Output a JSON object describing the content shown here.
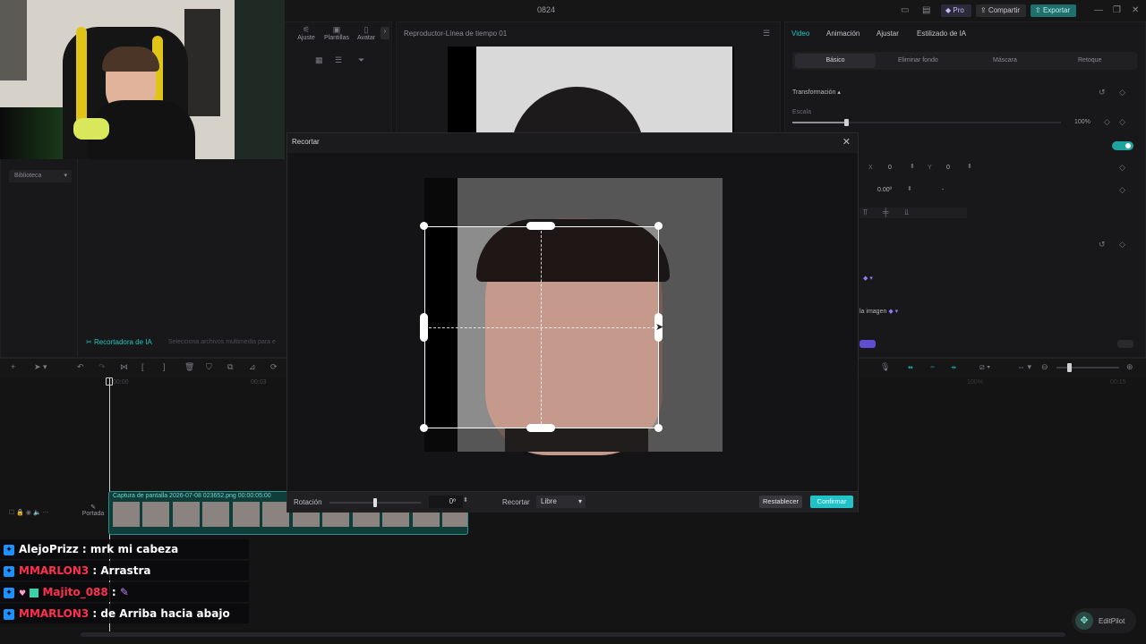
{
  "window": {
    "title": "0824",
    "pro_label": "Pro",
    "share_label": "Compartir",
    "export_label": "Exportar"
  },
  "left_toolbar": {
    "tabs": [
      "Ajuste",
      "Plantillas",
      "Avatar"
    ]
  },
  "library": {
    "dropdown_label": "Biblioteca",
    "ai_cutouts_label": "Recortadora de IA",
    "hint": "Selecciona archivos multimedia para e"
  },
  "player": {
    "title": "Reproductor-Línea de tiempo 01"
  },
  "inspector": {
    "tabs": [
      "Video",
      "Animación",
      "Ajustar",
      "Estilizado de IA"
    ],
    "subtabs": [
      "Básico",
      "Eliminar fondo",
      "Máscara",
      "Retoque"
    ],
    "transform_label": "Transformación",
    "scale_label": "Escala",
    "scale_value": "100%",
    "pos_x_label": "X",
    "pos_x_value": "0",
    "pos_y_label": "Y",
    "pos_y_value": "0",
    "rotation_value": "0.00º",
    "rotation_dash": "-",
    "enhance_label": "la imagen"
  },
  "timeline": {
    "time_left": "00:00",
    "time_mid": "00:03",
    "time_right_1": "100%",
    "time_right_2": "00:15",
    "cover_label": "Portada",
    "clip_label": "Captura de pantalla 2026-07-08 023652.png  00:00:05:00"
  },
  "crop_modal": {
    "title": "Recortar",
    "rotation_label": "Rotación",
    "rotation_value": "0º",
    "rotation_fraction": 0.5,
    "crop_label": "Recortar",
    "crop_select": "Libre",
    "reset_label": "Restablecer",
    "confirm_label": "Confirmar"
  },
  "chat": [
    {
      "user": "AlejoPrizz",
      "message": "mrk mi cabeza",
      "color": "#ffffff"
    },
    {
      "user": "MMARLON3",
      "message": "Arrastra",
      "color": "#ff2f4f"
    },
    {
      "user": "Majito_088",
      "message": "",
      "color": "#ff2f4f"
    },
    {
      "user": "MMARLON3",
      "message": "de Arriba hacia abajo",
      "color": "#ff2f4f"
    }
  ],
  "editpilot": {
    "label": "EditPilot"
  },
  "colors": {
    "accent": "#1fc7c0",
    "confirm": "#22c3c8",
    "chat_badge": "#1e90ff"
  }
}
